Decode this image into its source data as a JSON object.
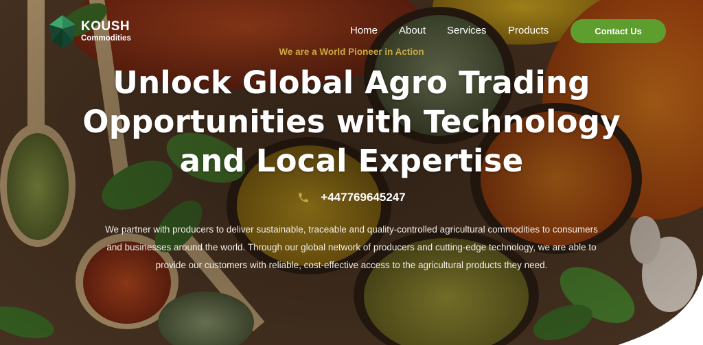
{
  "brand": {
    "name": "KOUSH",
    "subtitle": "Commodities",
    "logo_icon": "gem-diamond-icon"
  },
  "nav": {
    "items": [
      {
        "label": "Home"
      },
      {
        "label": "About"
      },
      {
        "label": "Services"
      },
      {
        "label": "Products"
      }
    ],
    "contact_label": "Contact Us"
  },
  "hero": {
    "tagline": "We are a World Pioneer in Action",
    "headline": "Unlock Global Agro Trading Opportunities with Technology and Local Expertise",
    "phone": "+447769645247",
    "phone_icon": "phone-icon",
    "description": "We partner with producers to deliver sustainable, traceable and quality-controlled agricultural commodities to consumers and businesses around the world. Through our global network of producers and cutting-edge technology, we are able to provide our customers with reliable, cost-effective access to the agricultural products they need."
  },
  "colors": {
    "accent_green": "#5e9e2e",
    "tagline_gold": "#c9a940",
    "text_white": "#ffffff"
  }
}
